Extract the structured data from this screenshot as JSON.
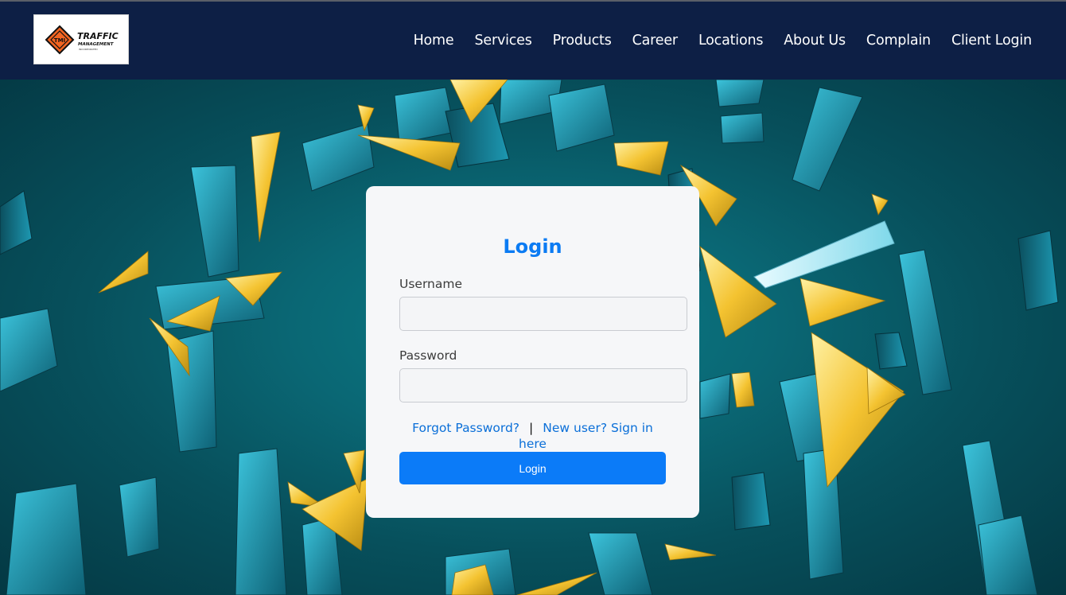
{
  "header": {
    "logo": {
      "brand_line1": "TRAFFIC",
      "brand_line2": "MANAGEMENT",
      "brand_line3": "INCORPORATED",
      "badge": "TMI"
    },
    "nav": [
      "Home",
      "Services",
      "Products",
      "Career",
      "Locations",
      "About Us",
      "Complain",
      "Client Login"
    ]
  },
  "login": {
    "title": "Login",
    "username_label": "Username",
    "username_value": "",
    "password_label": "Password",
    "password_value": "",
    "forgot_link": "Forgot Password?",
    "separator": "|",
    "signup_link": "New user? Sign in here",
    "button_label": "Login"
  },
  "colors": {
    "header_bg": "#0d1f45",
    "accent": "#0b7bf8",
    "card_bg": "#f6f7f9",
    "logo_orange": "#f26522",
    "shard_teal": "#1b8fa8",
    "shard_gold": "#f2c233"
  }
}
